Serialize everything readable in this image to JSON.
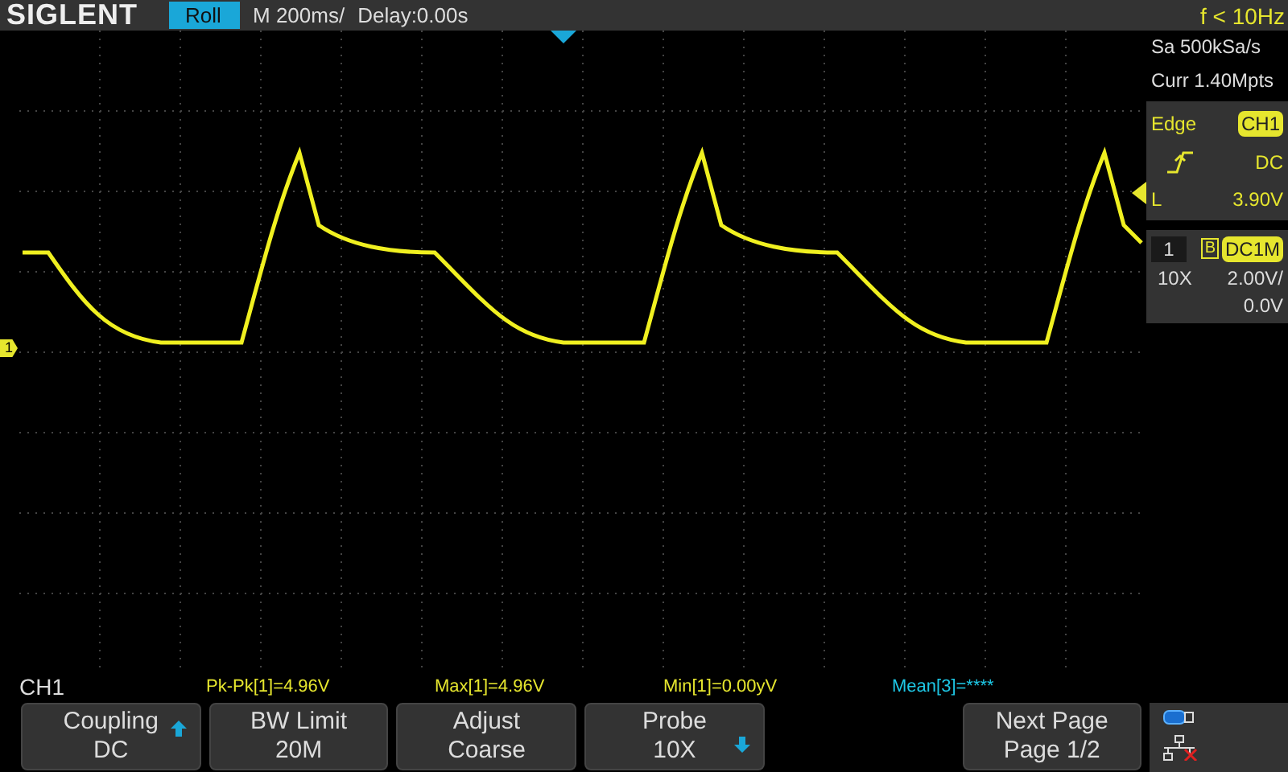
{
  "header": {
    "logo": "SIGLENT",
    "mode": "Roll",
    "timebase": "M 200ms/",
    "delay": "Delay:0.00s",
    "frequency": "f < 10Hz"
  },
  "acquisition": {
    "sample_rate": "Sa 500kSa/s",
    "memory": "Curr 1.40Mpts"
  },
  "trigger": {
    "type": "Edge",
    "source": "CH1",
    "coupling": "DC",
    "level_label": "L",
    "level": "3.90V"
  },
  "channel": {
    "number": "1",
    "bandwidth_flag": "B",
    "coupling_impedance": "DC1M",
    "probe": "10X",
    "scale": "2.00V/",
    "offset": "0.0V",
    "marker": "1"
  },
  "footer": {
    "channel": "CH1",
    "measurements": [
      {
        "text": "Pk-Pk[1]=4.96V",
        "color": "#e6e62e"
      },
      {
        "text": "Max[1]=4.96V",
        "color": "#e6e62e"
      },
      {
        "text": "Min[1]=0.00yV",
        "color": "#e6e62e"
      },
      {
        "text": "Mean[3]=****",
        "color": "#1ec8e6"
      }
    ]
  },
  "softkeys": [
    {
      "label": "Coupling",
      "value": "DC",
      "kind": "up"
    },
    {
      "label": "BW Limit",
      "value": "20M",
      "kind": "plain"
    },
    {
      "label": "Adjust",
      "value": "Coarse",
      "kind": "plain"
    },
    {
      "label": "Probe",
      "value": "10X",
      "kind": "down"
    },
    {
      "kind": "blank"
    },
    {
      "label": "Next Page",
      "value": "Page 1/2",
      "kind": "plain"
    }
  ]
}
